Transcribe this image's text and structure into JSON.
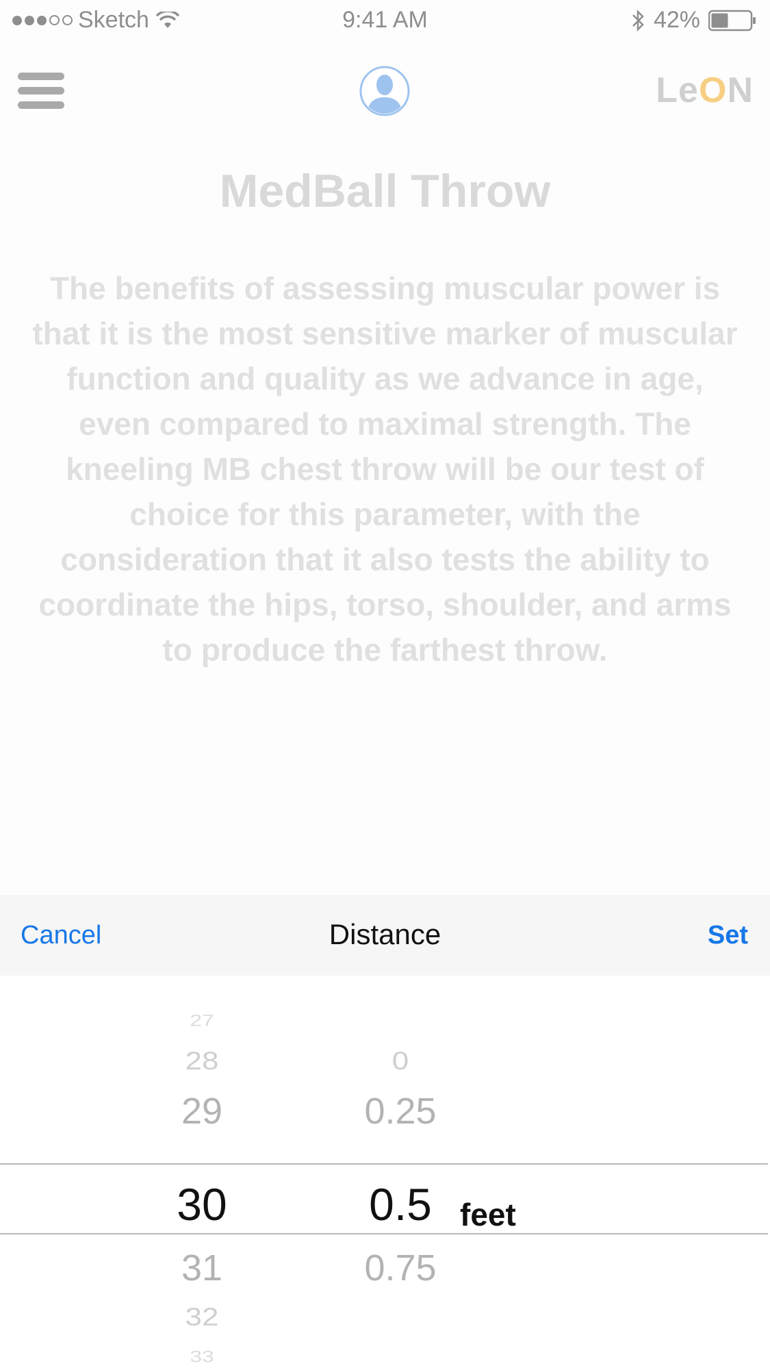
{
  "status_bar": {
    "carrier": "Sketch",
    "time": "9:41 AM",
    "battery": "42%",
    "icons": [
      "signal-dots",
      "wifi-icon",
      "bluetooth-icon",
      "battery-icon"
    ]
  },
  "nav": {
    "menu_icon": "hamburger-menu-icon",
    "avatar_icon": "user-avatar-icon",
    "brand": {
      "part1": "Le",
      "accent": "O",
      "part2": "N"
    }
  },
  "content": {
    "title": "MedBall Throw",
    "description": "The benefits of assessing muscular power is that it is the most sensitive marker of muscular function and quality as we advance in age, even compared to maximal strength. The kneeling MB chest throw will be our test of choice for this parameter, with the consideration that it also tests the ability to coordinate the hips, torso, shoulder, and arms to produce the farthest throw."
  },
  "picker": {
    "cancel_label": "Cancel",
    "title": "Distance",
    "set_label": "Set",
    "feet_options": [
      "27",
      "28",
      "29",
      "30",
      "31",
      "32",
      "33"
    ],
    "fraction_options": [
      "0",
      "0.25",
      "0.5",
      "0.75"
    ],
    "selected_feet": "30",
    "selected_fraction": "0.5",
    "unit": "feet"
  },
  "colors": {
    "accent_blue": "#1677e8",
    "brand_accent": "#f7cf83",
    "avatar_blue": "#9ec3ee"
  }
}
